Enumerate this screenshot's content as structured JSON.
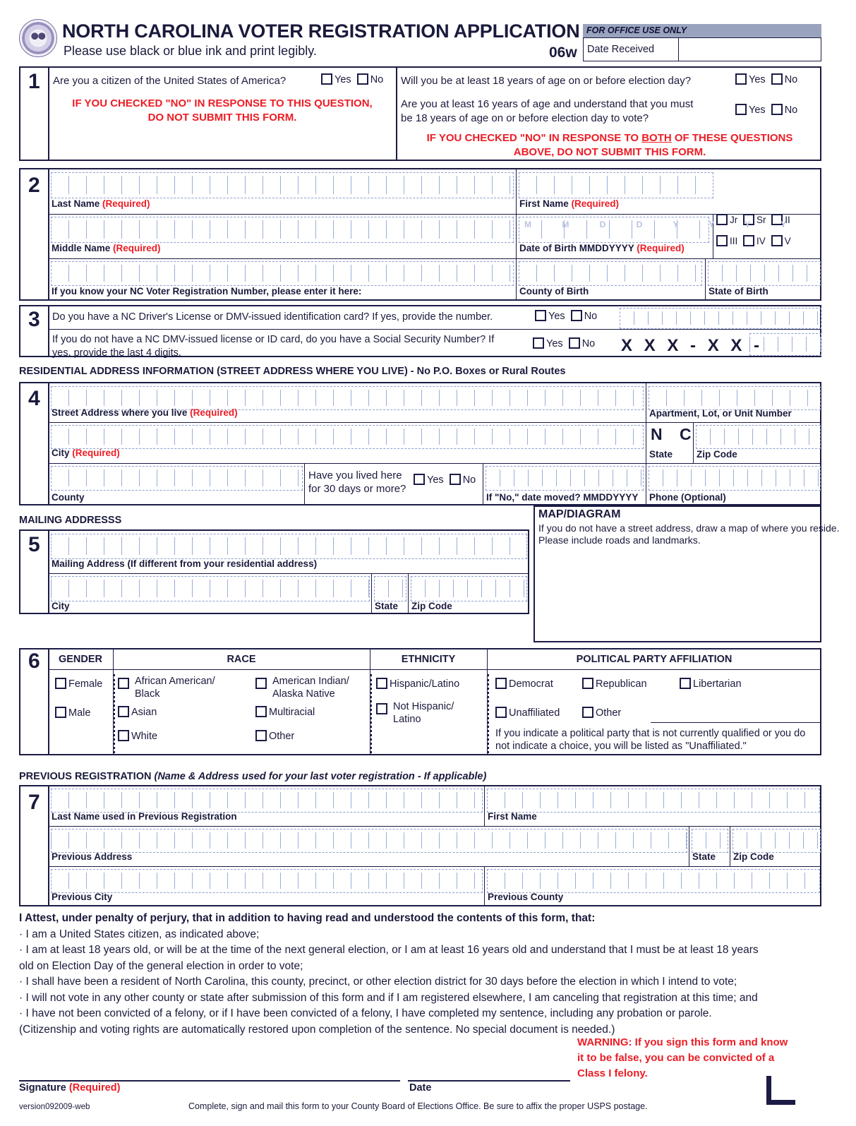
{
  "header": {
    "title": "NORTH CAROLINA VOTER REGISTRATION APPLICATION",
    "subtitle": "Please use black or blue ink and print legibly.",
    "form_code": "06w",
    "office_use_label": "FOR OFFICE USE ONLY",
    "date_received_label": "Date Received",
    "seal_name": "nc-state-seal"
  },
  "section1": {
    "number": "1",
    "citizen_question": "Are you a citizen of the United States of America?",
    "yes": "Yes",
    "no": "No",
    "citizen_warning_line1": "IF YOU CHECKED \"NO\" IN  RESPONSE TO THIS QUESTION,",
    "citizen_warning_line2": "DO NOT SUBMIT THIS FORM.",
    "age18_question": "Will you be at least 18 years of age on or before election day?",
    "age16_question_line1": "Are you at least 16 years of age and understand that you must",
    "age16_question_line2": "be 18 years of age on or before election day to vote?",
    "age_warning_pre": "IF YOU CHECKED \"NO\" IN RESPONSE TO ",
    "age_warning_both": "BOTH",
    "age_warning_post": " OF THESE QUESTIONS",
    "age_warning_line2": "ABOVE, DO NOT SUBMIT THIS FORM."
  },
  "section2": {
    "number": "2",
    "last_name_label": "Last Name",
    "last_name_required": "(Required)",
    "first_name_label": "First Name",
    "first_name_required": "(Required)",
    "middle_name_label": "Middle Name",
    "middle_name_required": "(Required)",
    "dob_label": "Date of Birth MMDDYYYY",
    "dob_required": "(Required)",
    "dob_guide": "M M D D Y Y Y Y",
    "voter_reg_label": "If you know your NC Voter Registration Number, please enter it here:",
    "county_of_birth_label": "County of Birth",
    "state_of_birth_label": "State of Birth",
    "suffixes": [
      "Jr",
      "Sr",
      "II",
      "III",
      "IV",
      "V"
    ]
  },
  "section3": {
    "number": "3",
    "dl_question": "Do you have a NC Driver's License or DMV-issued identification card? If yes, provide the number.",
    "ssn_question_line1": "If you do not have a NC  DMV-issued license or ID card, do you have a Social Security Number? If",
    "ssn_question_line2": "yes, provide the last 4 digits.",
    "yes": "Yes",
    "no": "No",
    "ssn_mask": "X X X - X X -"
  },
  "section4": {
    "number": "4",
    "banner": "RESIDENTIAL ADDRESS INFORMATION (STREET ADDRESS WHERE YOU LIVE) - No P.O. Boxes or Rural Routes",
    "street_label": "Street Address where you live",
    "street_required": "(Required)",
    "apartment_label": "Apartment, Lot, or Unit Number",
    "city_label": "City",
    "city_required": "(Required)",
    "state_value": "N C",
    "state_label": "State",
    "zip_label": "Zip Code",
    "county_label": "County",
    "lived_question_line1": "Have you lived here",
    "lived_question_line2": "for 30 days or more?",
    "yes": "Yes",
    "no": "No",
    "date_moved_label": "If \"No,\" date moved? MMDDYYYY",
    "phone_label": "Phone (Optional)"
  },
  "section5": {
    "number": "5",
    "banner": "MAILING ADDRESSS",
    "mailing_label": "Mailing Address (If different from your residential address)",
    "city_label": "City",
    "state_label": "State",
    "zip_label": "Zip Code",
    "map_title": "MAP/DIAGRAM",
    "map_line1": "If you do not have a street address, draw  a map of where you reside.",
    "map_line2": "Please include roads and landmarks."
  },
  "section6": {
    "number": "6",
    "gender_header": "GENDER",
    "race_header": "RACE",
    "ethnicity_header": "ETHNICITY",
    "party_header": "POLITICAL PARTY AFFILIATION",
    "gender_options": [
      "Female",
      "Male"
    ],
    "race_col1": [
      "African American/\nBlack",
      "Asian",
      "White"
    ],
    "race_col2": [
      "American Indian/\nAlaska Native",
      "Multiracial",
      "Other"
    ],
    "ethnicity_options": [
      "Hispanic/Latino",
      "Not Hispanic/\nLatino"
    ],
    "party_row1": [
      "Democrat",
      "Republican",
      "Libertarian"
    ],
    "party_row2": [
      "Unaffiliated",
      "Other"
    ],
    "party_note_line1": "If you indicate a political party that is not currently qualified or you do",
    "party_note_line2": "not indicate a choice, you will be listed as \"Unaffiliated.\""
  },
  "section7": {
    "number": "7",
    "banner_bold": "PREVIOUS REGISTRATION ",
    "banner_italic": "(Name & Address used for your last voter registration - If applicable)",
    "last_name_label": "Last Name used in Previous Registration",
    "first_name_label": "First Name",
    "previous_address_label": "Previous Address",
    "state_label": "State",
    "zip_label": "Zip Code",
    "previous_city_label": "Previous City",
    "previous_county_label": "Previous County"
  },
  "attest": {
    "title": "I Attest, under penalty of perjury, that in addition to having read and understood the contents of this form, that:",
    "items": [
      "· I am a United States citizen, as indicated above;",
      "· I am at least 18 years old, or will be at the time of the next general election, or I am at least 16 years old and understand that I must be at least 18 years",
      "  old on Election Day of the general election in order to vote;",
      "· I shall have been a resident of North Carolina, this county, precinct, or other election district for 30 days before the election in which I intend to vote;",
      "· I will not vote in any other county or state after submission of this form and if I am registered elsewhere, I am canceling that registration at this time;  and",
      "· I have not been convicted of a felony, or if I have been convicted of a felony, I have completed my sentence, including any probation or parole.",
      "  (Citizenship and voting rights are automatically restored upon completion of the sentence. No special document is needed.)"
    ]
  },
  "footer": {
    "signature_label": "Signature",
    "signature_required": "(Required)",
    "date_label": "Date",
    "warning_line1": "WARNING: If you sign this form and know",
    "warning_line2": "it to be false, you can be convicted of a",
    "warning_line3": "Class I felony.",
    "version": "version092009-web",
    "mail_instruction": "Complete, sign and mail this form to your County Board of Elections Office. Be sure to affix the proper USPS postage."
  }
}
